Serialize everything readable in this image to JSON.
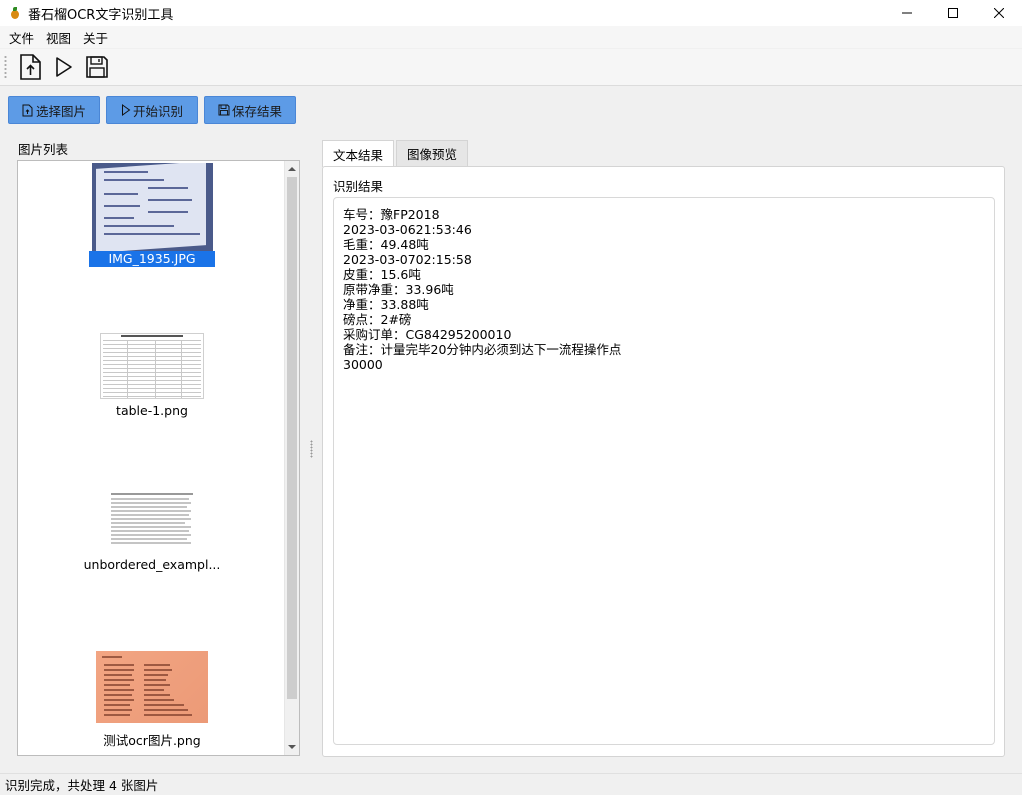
{
  "window": {
    "title": "番石榴OCR文字识别工具"
  },
  "menu": [
    "文件",
    "视图",
    "关于"
  ],
  "toolbar": {
    "icons": [
      "open-file-icon",
      "play-icon",
      "save-icon"
    ]
  },
  "actions": {
    "select_image": "选择图片",
    "start_recognition": "开始识别",
    "save_result": "保存结果"
  },
  "image_list": {
    "label": "图片列表",
    "items": [
      {
        "name": "IMG_1935.JPG",
        "selected": true
      },
      {
        "name": "table-1.png",
        "selected": false
      },
      {
        "name": "unbordered_exampl...",
        "selected": false
      },
      {
        "name": "测试ocr图片.png",
        "selected": false
      }
    ]
  },
  "tabs": [
    {
      "label": "文本结果",
      "active": true
    },
    {
      "label": "图像预览",
      "active": false
    }
  ],
  "result": {
    "label": "识别结果",
    "lines": [
      "车号：豫FP2018",
      "2023-03-0621:53:46",
      "毛重：49.48吨",
      "2023-03-0702:15:58",
      "皮重：15.6吨",
      "原带净重：33.96吨",
      "净重：33.88吨",
      "磅点：2#磅",
      "采购订单：CG84295200010",
      "备注：计量完毕20分钟内必须到达下一流程操作点",
      "30000"
    ]
  },
  "status": "识别完成，共处理 4 张图片",
  "colors": {
    "accent": "#5d9be6",
    "selection": "#1a73e8"
  }
}
